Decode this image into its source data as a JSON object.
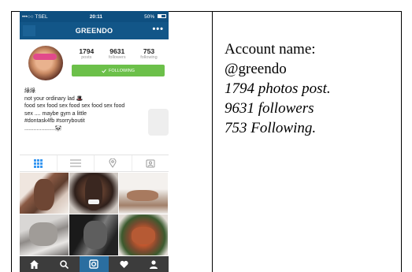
{
  "status_bar": {
    "carrier": "•••○○ TSEL",
    "wifi_icon": "wifi-icon",
    "time": "20:11",
    "battery": "50%"
  },
  "nav": {
    "title": "GREENDO",
    "more_label": "•••"
  },
  "profile": {
    "stats": [
      {
        "value": "1794",
        "label": "posts"
      },
      {
        "value": "9631",
        "label": "followers"
      },
      {
        "value": "753",
        "label": "following"
      }
    ],
    "follow_label": "FOLLOWING",
    "follow_color": "#6cc04a"
  },
  "bio": {
    "name": "綠綠",
    "line1": "not your ordinary lad",
    "line2": "food sex food sex food sex food sex food",
    "line3": "sex .... maybe gym a little",
    "line4": "#dontask4fb #sorryboutit",
    "line5": "...................."
  },
  "tabs": [
    "grid-icon",
    "list-icon",
    "location-icon",
    "tagged-icon"
  ],
  "bottom_nav": [
    "home-icon",
    "search-icon",
    "camera-icon",
    "activity-icon",
    "profile-icon"
  ],
  "caption": {
    "line1": "Account name:",
    "line2": "@greendo",
    "line3": "1794 photos post.",
    "line4": "9631 followers",
    "line5": "753 Following."
  },
  "colors": {
    "nav_blue": "#125688",
    "status_blue": "#0e4f80",
    "active_tab": "#2a6ea0",
    "bottom_bar": "#3c3c3c"
  }
}
